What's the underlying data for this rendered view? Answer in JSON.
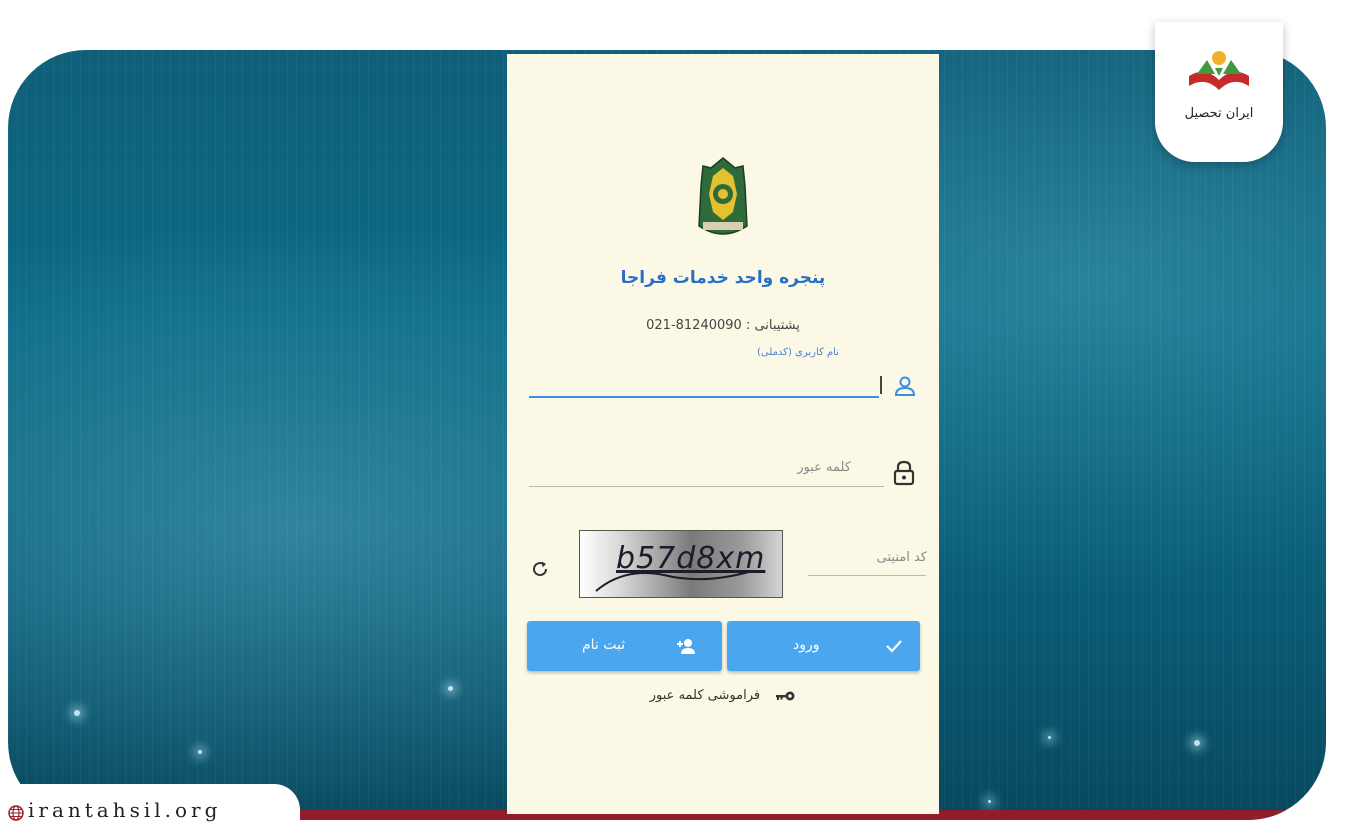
{
  "panel": {
    "title": "پنجره واحد خدمات فراجا",
    "support_label": "پشتیبانی :",
    "support_phone": "021-81240090",
    "username_label": "نام کاربری (کدملی)",
    "password_placeholder": "کلمه عبور",
    "security_code_placeholder": "کد امنیتی",
    "captcha_text": "b57d8xm",
    "login_button": "ورود",
    "register_button": "ثبت نام",
    "forgot_password": "فراموشی کلمه عبور"
  },
  "brand": {
    "name": "ایران تحصیل",
    "watermark": "irantahsil.org"
  },
  "colors": {
    "accent": "#4aa6ef",
    "title": "#2a6fc6",
    "panel_bg": "#fbf9e6",
    "background": "#0b6a86",
    "bottom_bar": "#8f1e2a"
  },
  "icons": [
    "user-icon",
    "lock-icon",
    "refresh-icon",
    "check-icon",
    "add-user-icon",
    "key-icon",
    "globe-icon",
    "emblem-icon"
  ]
}
